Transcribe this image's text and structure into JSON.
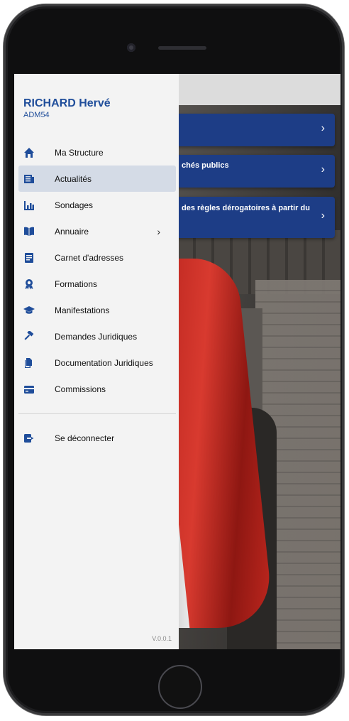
{
  "user": {
    "name": "RICHARD Hervé",
    "code": "ADM54"
  },
  "menu": [
    {
      "label": "Ma Structure",
      "icon": "home-icon"
    },
    {
      "label": "Actualités",
      "icon": "news-icon",
      "active": true
    },
    {
      "label": "Sondages",
      "icon": "bar-chart-icon"
    },
    {
      "label": "Annuaire",
      "icon": "book-open-icon",
      "has_submenu": true
    },
    {
      "label": "Carnet d'adresses",
      "icon": "address-book-icon"
    },
    {
      "label": "Formations",
      "icon": "award-icon"
    },
    {
      "label": "Manifestations",
      "icon": "graduation-cap-icon"
    },
    {
      "label": "Demandes Juridiques",
      "icon": "gavel-icon"
    },
    {
      "label": "Documentation Juridiques",
      "icon": "documents-icon"
    },
    {
      "label": "Commissions",
      "icon": "card-icon"
    }
  ],
  "logout": {
    "label": "Se déconnecter",
    "icon": "logout-icon"
  },
  "version": "V.0.0.1",
  "cards": [
    {
      "text": ""
    },
    {
      "text": "chés publics"
    },
    {
      "text": "des règles dérogatoires à partir du"
    }
  ],
  "colors": {
    "accent": "#1f4d9a",
    "card": "#1d3d86",
    "active_row": "#d4dbe6"
  }
}
